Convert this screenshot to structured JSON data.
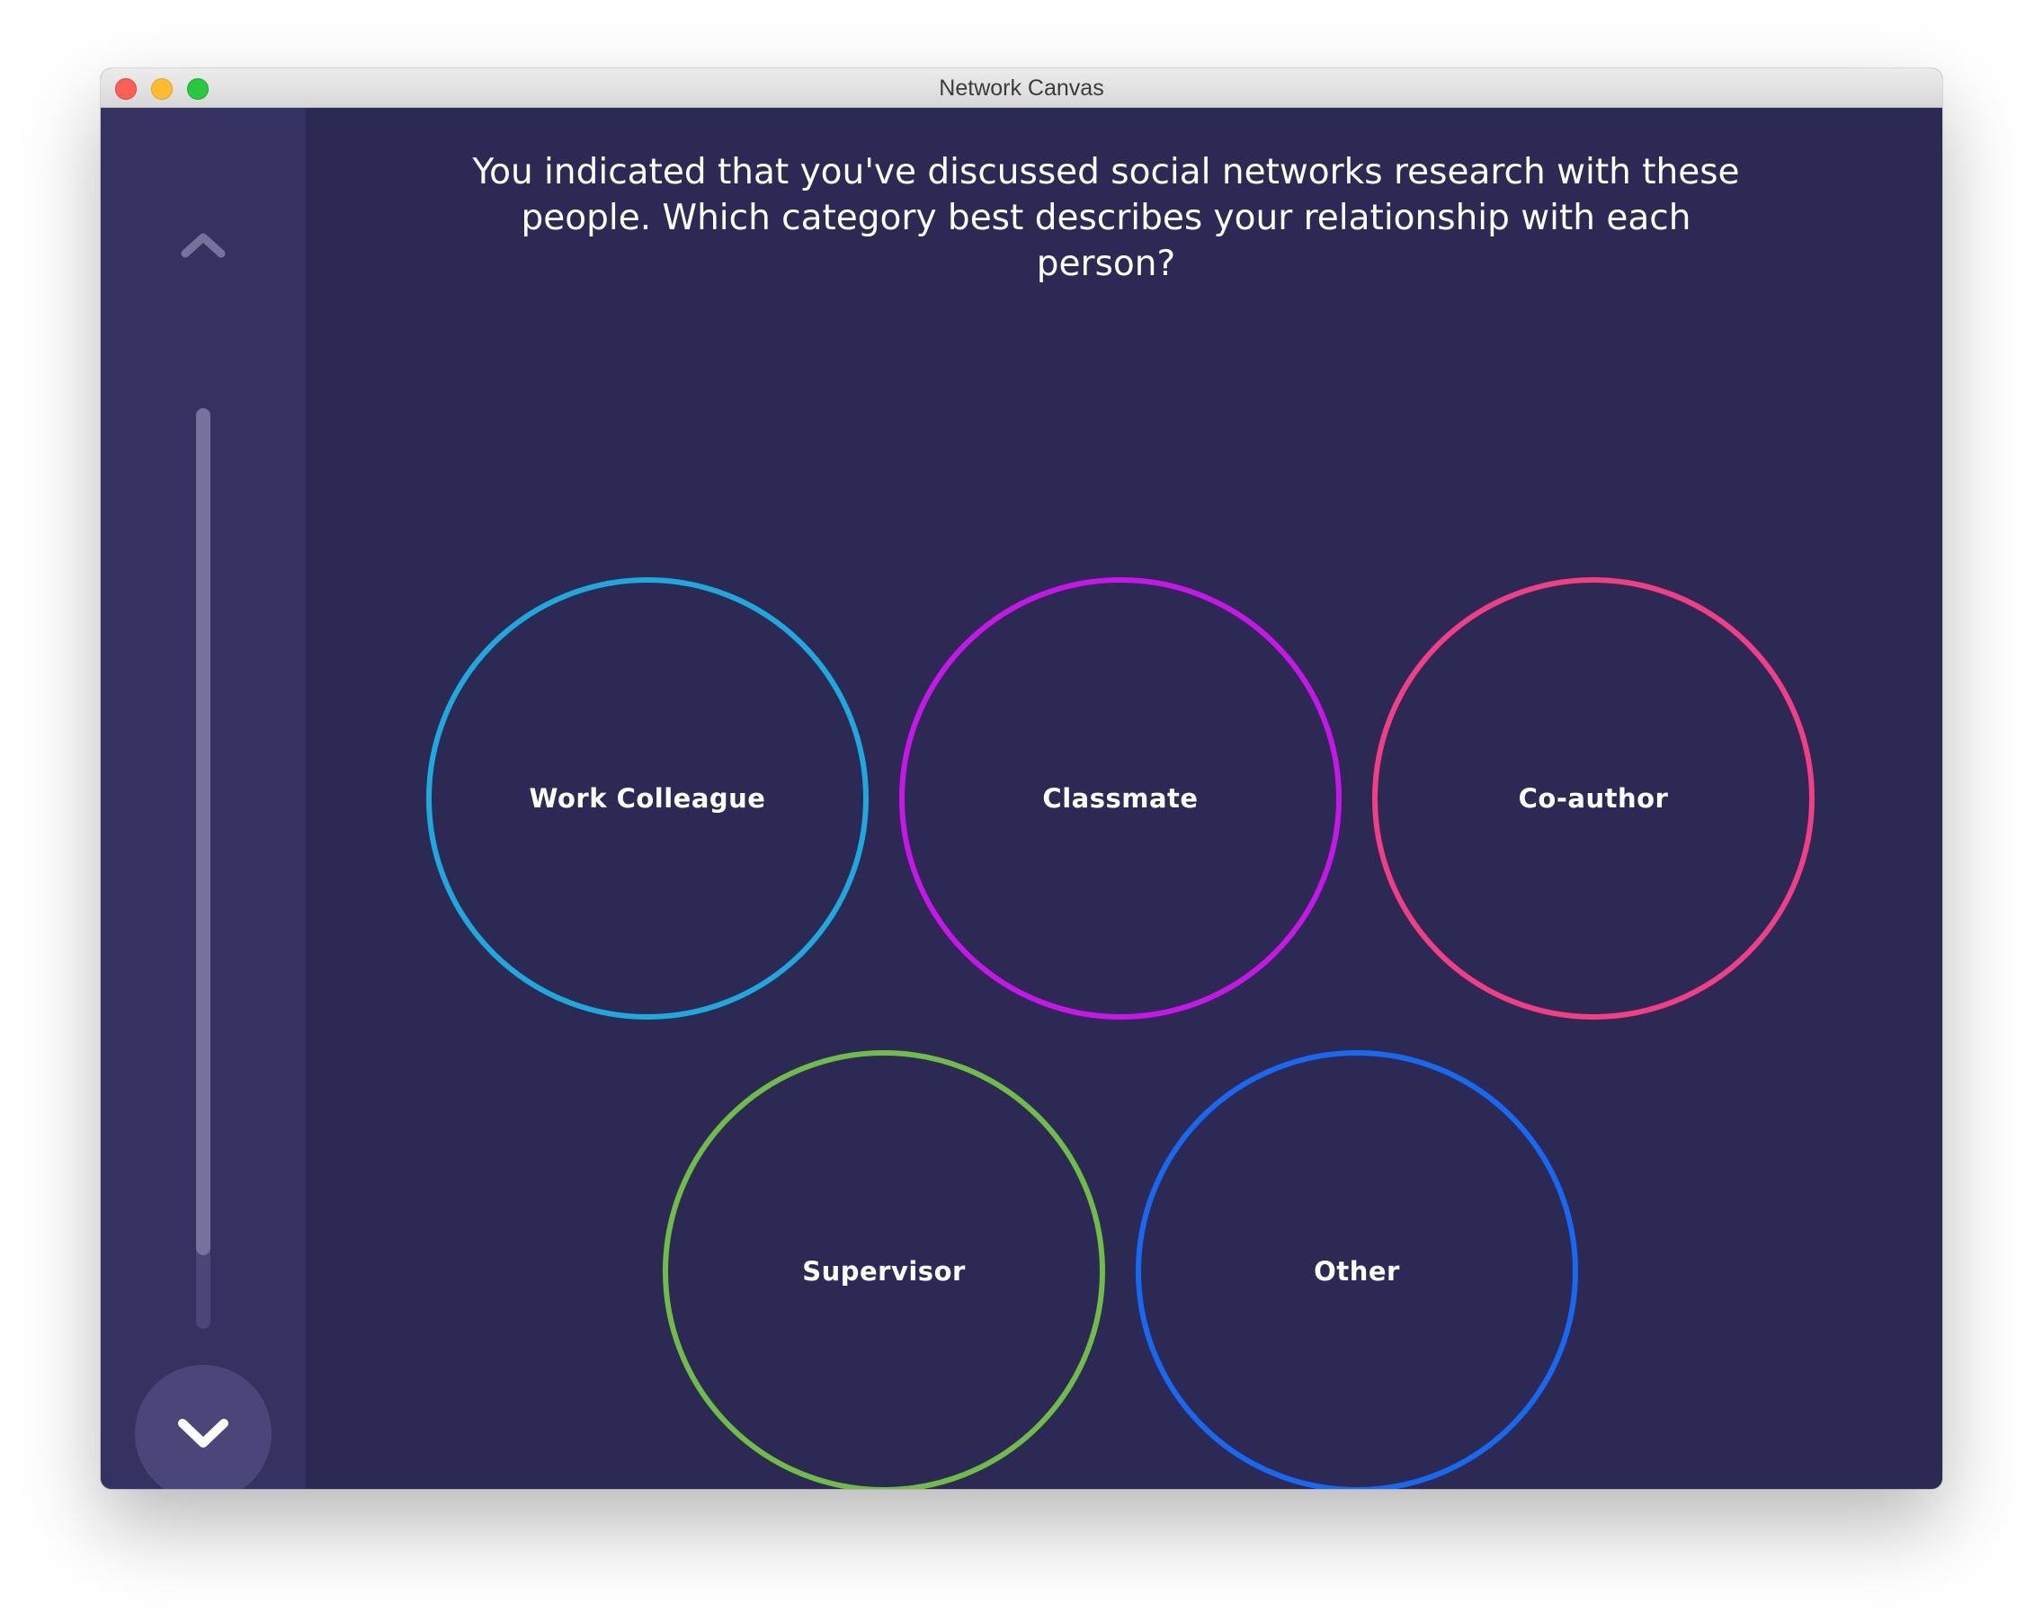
{
  "window": {
    "title": "Network Canvas"
  },
  "prompt": {
    "line1": "You indicated that you've discussed social networks research with these",
    "line2": "people. Which category best describes your relationship with each person?"
  },
  "navigation": {
    "up_icon": "chevron-up-icon",
    "down_icon": "chevron-down-icon",
    "progress_fraction": 0.92
  },
  "bins": [
    {
      "label": "Work Colleague",
      "color": "#1fa8dc"
    },
    {
      "label": "Classmate",
      "color": "#c717e8"
    },
    {
      "label": "Co-author",
      "color": "#f23e87"
    },
    {
      "label": "Supervisor",
      "color": "#6fbc48"
    },
    {
      "label": "Other",
      "color": "#1769f2"
    }
  ]
}
